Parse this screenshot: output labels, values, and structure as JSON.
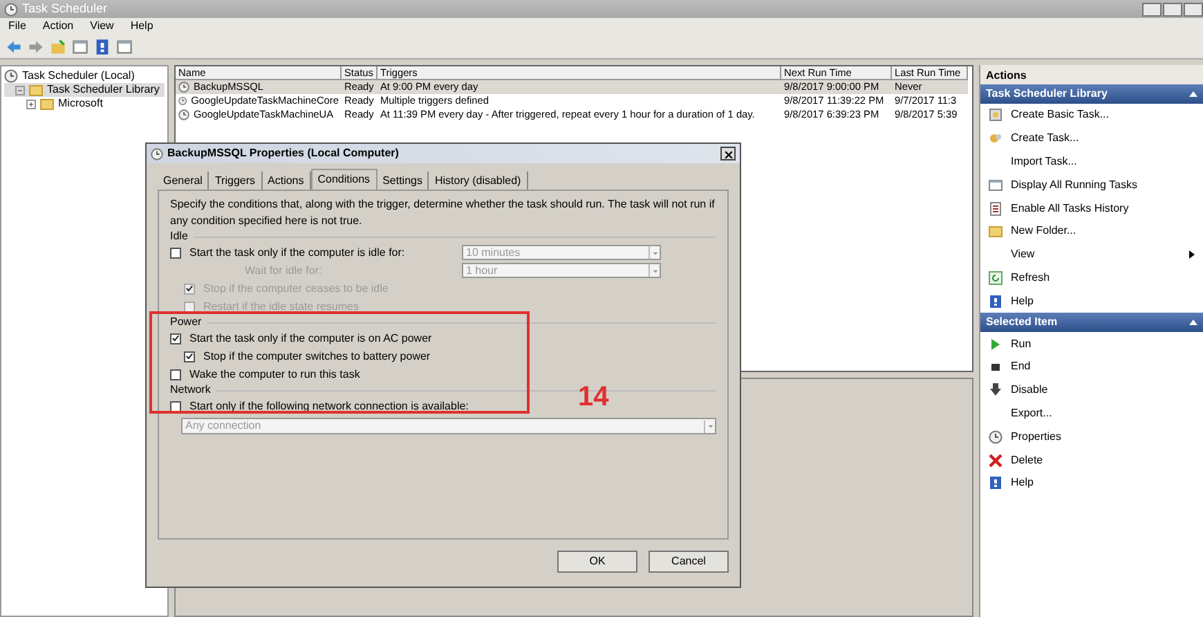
{
  "window": {
    "title": "Task Scheduler"
  },
  "menu": [
    "File",
    "Action",
    "View",
    "Help"
  ],
  "tree": [
    {
      "label": "Task Scheduler (Local)",
      "selected": false,
      "children": [
        {
          "label": "Task Scheduler Library",
          "expanded": true,
          "selected": true,
          "children": [
            {
              "label": "Microsoft",
              "expanded": false,
              "selected": false
            }
          ]
        }
      ]
    }
  ],
  "table": {
    "columns": [
      "Name",
      "Status",
      "Triggers",
      "Next Run Time",
      "Last Run Time"
    ],
    "rows": [
      {
        "selected": true,
        "cells": [
          "BackupMSSQL",
          "Ready",
          "At 9:00 PM every day",
          "9/8/2017 9:00:00 PM",
          "Never"
        ]
      },
      {
        "selected": false,
        "cells": [
          "GoogleUpdateTaskMachineCore",
          "Ready",
          "Multiple triggers defined",
          "9/8/2017 11:39:22 PM",
          "9/7/2017 11:3"
        ]
      },
      {
        "selected": false,
        "cells": [
          "GoogleUpdateTaskMachineUA",
          "Ready",
          "At 11:39 PM every day - After triggered, repeat every 1 hour for a duration of 1 day.",
          "9/8/2017 6:39:23 PM",
          "9/8/2017 5:39"
        ]
      }
    ]
  },
  "actions": {
    "title": "Actions",
    "sections": [
      {
        "title": "Task Scheduler Library",
        "items": [
          {
            "label": "Create Basic Task...",
            "kind": "command"
          },
          {
            "label": "Create Task...",
            "kind": "command"
          },
          {
            "label": "Import Task...",
            "kind": "command"
          },
          {
            "label": "Display All Running Tasks",
            "kind": "command"
          },
          {
            "label": "Enable All Tasks History",
            "kind": "command"
          },
          {
            "label": "New Folder...",
            "kind": "command"
          },
          {
            "label": "View",
            "kind": "submenu"
          },
          {
            "label": "Refresh",
            "kind": "command"
          },
          {
            "label": "Help",
            "kind": "command"
          }
        ]
      },
      {
        "title": "Selected Item",
        "items": [
          {
            "label": "Run",
            "kind": "command"
          },
          {
            "label": "End",
            "kind": "command"
          },
          {
            "label": "Disable",
            "kind": "command"
          },
          {
            "label": "Export...",
            "kind": "command"
          },
          {
            "label": "Properties",
            "kind": "command"
          },
          {
            "label": "Delete",
            "kind": "command"
          },
          {
            "label": "Help",
            "kind": "command"
          }
        ]
      }
    ]
  },
  "dialog": {
    "title": "BackupMSSQL Properties (Local Computer)",
    "tabs": [
      {
        "label": "General",
        "selected": false
      },
      {
        "label": "Triggers",
        "selected": false
      },
      {
        "label": "Actions",
        "selected": false
      },
      {
        "label": "Conditions",
        "selected": true
      },
      {
        "label": "Settings",
        "selected": false
      },
      {
        "label": "History (disabled)",
        "selected": false
      }
    ],
    "intro": "Specify the conditions that, along with the trigger, determine whether the task should run.  The task will not run  if any condition specified here is not true.",
    "groups": [
      {
        "title": "Idle",
        "rows": [
          {
            "kind": "checkbox",
            "label": "Start the task only if the computer is idle for:",
            "checked": false,
            "disabled": false,
            "indent": false,
            "select": "10 minutes"
          },
          {
            "kind": "label",
            "label": "Wait for idle for:",
            "disabled": true,
            "select": "1 hour"
          },
          {
            "kind": "checkbox",
            "label": "Stop if the computer ceases to be idle",
            "checked": true,
            "disabled": true,
            "indent": true
          },
          {
            "kind": "checkbox",
            "label": "Restart if the idle state resumes",
            "checked": false,
            "disabled": true,
            "indent": true
          }
        ]
      },
      {
        "title": "Power",
        "rows": [
          {
            "kind": "checkbox",
            "label": "Start the task only if the computer is on AC power",
            "checked": true,
            "disabled": false,
            "indent": false
          },
          {
            "kind": "checkbox",
            "label": "Stop if the computer switches to battery power",
            "checked": true,
            "disabled": false,
            "indent": true
          },
          {
            "kind": "checkbox",
            "label": "Wake the computer to run this task",
            "checked": false,
            "disabled": false,
            "indent": false
          }
        ]
      },
      {
        "title": "Network",
        "rows": [
          {
            "kind": "checkbox",
            "label": "Start only if the following network connection is available:",
            "checked": false,
            "disabled": false,
            "indent": false
          },
          {
            "kind": "wideselect",
            "label": "Any connection",
            "disabled": true
          }
        ]
      }
    ],
    "buttons": [
      "OK",
      "Cancel"
    ]
  },
  "annotation": {
    "label": "14"
  }
}
